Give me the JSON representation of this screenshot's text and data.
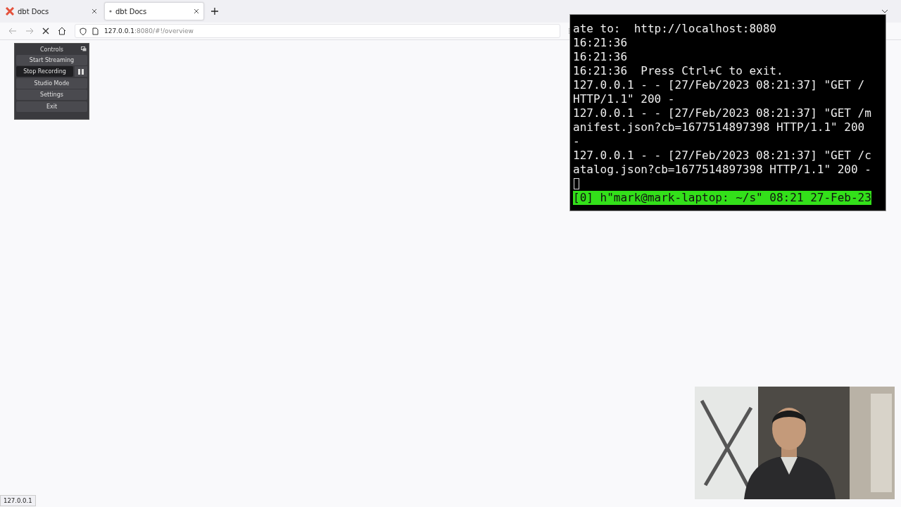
{
  "browser": {
    "tabs": [
      {
        "label": "dbt Docs",
        "selected": false
      },
      {
        "label": "dbt Docs",
        "selected": true
      }
    ],
    "url": {
      "host": "127.0.0.1",
      "rest": ":8080/#!/overview"
    },
    "loading": true
  },
  "controls_dock": {
    "title": "Controls",
    "buttons": [
      {
        "label": "Start Streaming",
        "active": false,
        "pause": false
      },
      {
        "label": "Stop Recording",
        "active": true,
        "pause": true
      },
      {
        "label": "Studio Mode",
        "active": false,
        "pause": false
      },
      {
        "label": "Settings",
        "active": false,
        "pause": false
      },
      {
        "label": "Exit",
        "active": false,
        "pause": false
      }
    ]
  },
  "terminal": {
    "lines": [
      "ate to:  http://localhost:8080",
      "16:21:36",
      "16:21:36",
      "16:21:36  Press Ctrl+C to exit.",
      "127.0.0.1 - - [27/Feb/2023 08:21:37] \"GET /",
      "HTTP/1.1\" 200 -",
      "127.0.0.1 - - [27/Feb/2023 08:21:37] \"GET /m",
      "anifest.json?cb=1677514897398 HTTP/1.1\" 200",
      "-",
      "127.0.0.1 - - [27/Feb/2023 08:21:37] \"GET /c",
      "atalog.json?cb=1677514897398 HTTP/1.1\" 200 -"
    ],
    "cursor": true,
    "status_line": "[0] h\"mark@mark-laptop: ~/s\" 08:21 27-Feb-23"
  },
  "status_bar": {
    "text": "127.0.0.1"
  }
}
